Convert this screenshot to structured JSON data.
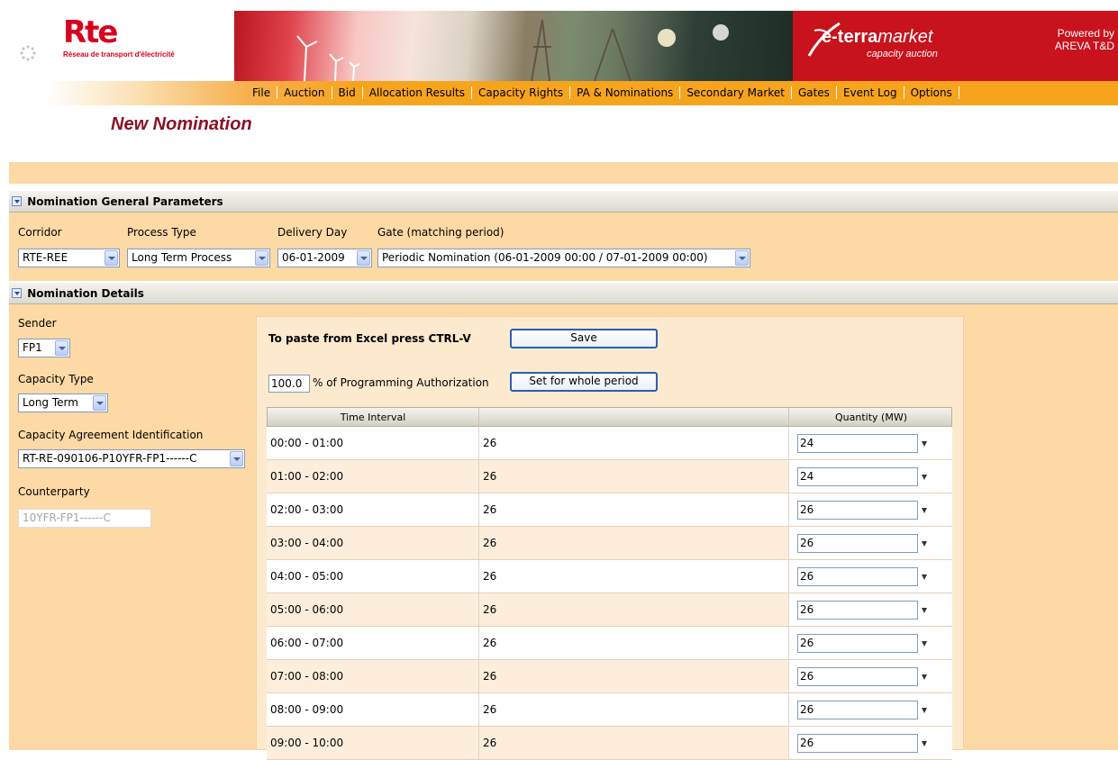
{
  "header": {
    "logo_text": "Rte",
    "logo_subtitle": "Réseau de transport d'électricité",
    "brand_title_prefix": "e-terra",
    "brand_title_suffix": "market",
    "brand_subtitle": "capacity auction",
    "powered_line1": "Powered by",
    "powered_line2": "AREVA T&D"
  },
  "menu": [
    "File",
    "Auction",
    "Bid",
    "Allocation Results",
    "Capacity Rights",
    "PA & Nominations",
    "Secondary Market",
    "Gates",
    "Event Log",
    "Options"
  ],
  "page_title": "New Nomination",
  "general": {
    "header": "Nomination General Parameters",
    "corridor_label": "Corridor",
    "corridor_value": "RTE-REE",
    "process_type_label": "Process Type",
    "process_type_value": "Long Term Process",
    "delivery_day_label": "Delivery Day",
    "delivery_day_value": "06-01-2009",
    "gate_label": "Gate (matching period)",
    "gate_value": "Periodic Nomination (06-01-2009 00:00 / 07-01-2009 00:00)"
  },
  "details": {
    "header": "Nomination Details",
    "sender_label": "Sender",
    "sender_value": "FP1",
    "capacity_type_label": "Capacity Type",
    "capacity_type_value": "Long Term",
    "agreement_label": "Capacity Agreement Identification",
    "agreement_value": "RT-RE-090106-P10YFR-FP1------C",
    "counterparty_label": "Counterparty",
    "counterparty_value": "10YFR-FP1------C"
  },
  "grid": {
    "paste_label": "To paste from Excel press CTRL-V",
    "save_label": "Save",
    "pct_value": "100.0",
    "pct_label": "% of Programming Authorization",
    "set_whole_label": "Set for whole period",
    "columns": [
      "Time Interval",
      "",
      "Quantity (MW)"
    ],
    "rows": [
      {
        "interval": "00:00 - 01:00",
        "value": "26",
        "quantity": "24"
      },
      {
        "interval": "01:00 - 02:00",
        "value": "26",
        "quantity": "24"
      },
      {
        "interval": "02:00 - 03:00",
        "value": "26",
        "quantity": "26"
      },
      {
        "interval": "03:00 - 04:00",
        "value": "26",
        "quantity": "26"
      },
      {
        "interval": "04:00 - 05:00",
        "value": "26",
        "quantity": "26"
      },
      {
        "interval": "05:00 - 06:00",
        "value": "26",
        "quantity": "26"
      },
      {
        "interval": "06:00 - 07:00",
        "value": "26",
        "quantity": "26"
      },
      {
        "interval": "07:00 - 08:00",
        "value": "26",
        "quantity": "26"
      },
      {
        "interval": "08:00 - 09:00",
        "value": "26",
        "quantity": "26"
      },
      {
        "interval": "09:00 - 10:00",
        "value": "26",
        "quantity": "26"
      }
    ]
  },
  "colors": {
    "rte_red": "#d8001c",
    "title_maroon": "#8b1226",
    "nav_orange": "#f7a41d",
    "panel_peach": "#fdd9a6"
  }
}
